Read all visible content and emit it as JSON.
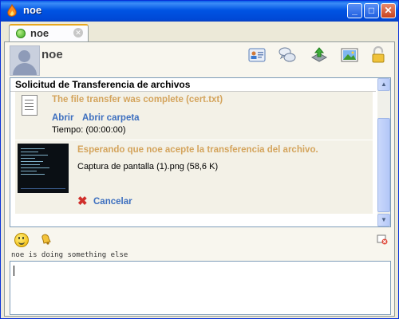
{
  "window": {
    "title": "noe"
  },
  "tab": {
    "label": "noe"
  },
  "header": {
    "contact_name": "noe"
  },
  "transfer": {
    "heading": "Solicitud de Transferencia de archivos",
    "complete_msg": "The file transfer was complete (cert.txt)",
    "open_link": "Abrir",
    "open_folder_link": "Abrir carpeta",
    "time": "Tiempo: (00:00:00)",
    "waiting_msg": "Esperando que noe acepte la transferencia del archivo.",
    "file_info": "Captura de pantalla (1).png (58,6 K)",
    "cancel_link": "Cancelar"
  },
  "status": {
    "text": "noe is doing something else"
  },
  "colors": {
    "accent_link": "#3d6fbf",
    "accent_notice": "#d4a45c"
  }
}
